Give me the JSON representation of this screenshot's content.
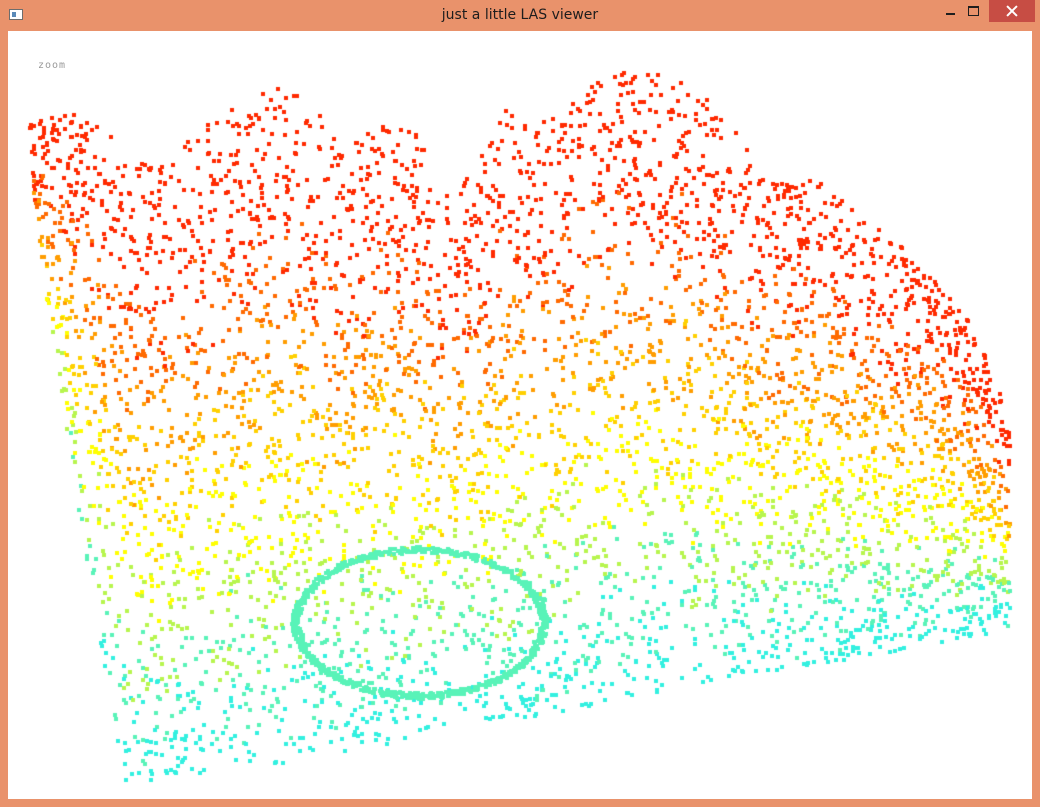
{
  "window": {
    "title": "just a little LAS viewer",
    "frame_color": "#e9926b",
    "close_color": "#c74d44"
  },
  "icons": {
    "app": "app-window-icon",
    "minimize": "minimize-icon",
    "maximize": "maximize-icon",
    "close": "close-icon"
  },
  "viewport": {
    "background": "#ffffff",
    "zoom_label": "zoom",
    "point_colors": [
      "#33f0e0",
      "#59f3b8",
      "#b7f54e",
      "#ffff00",
      "#ffd000",
      "#ff9d00",
      "#ff6a00",
      "#ff2a00"
    ]
  }
}
